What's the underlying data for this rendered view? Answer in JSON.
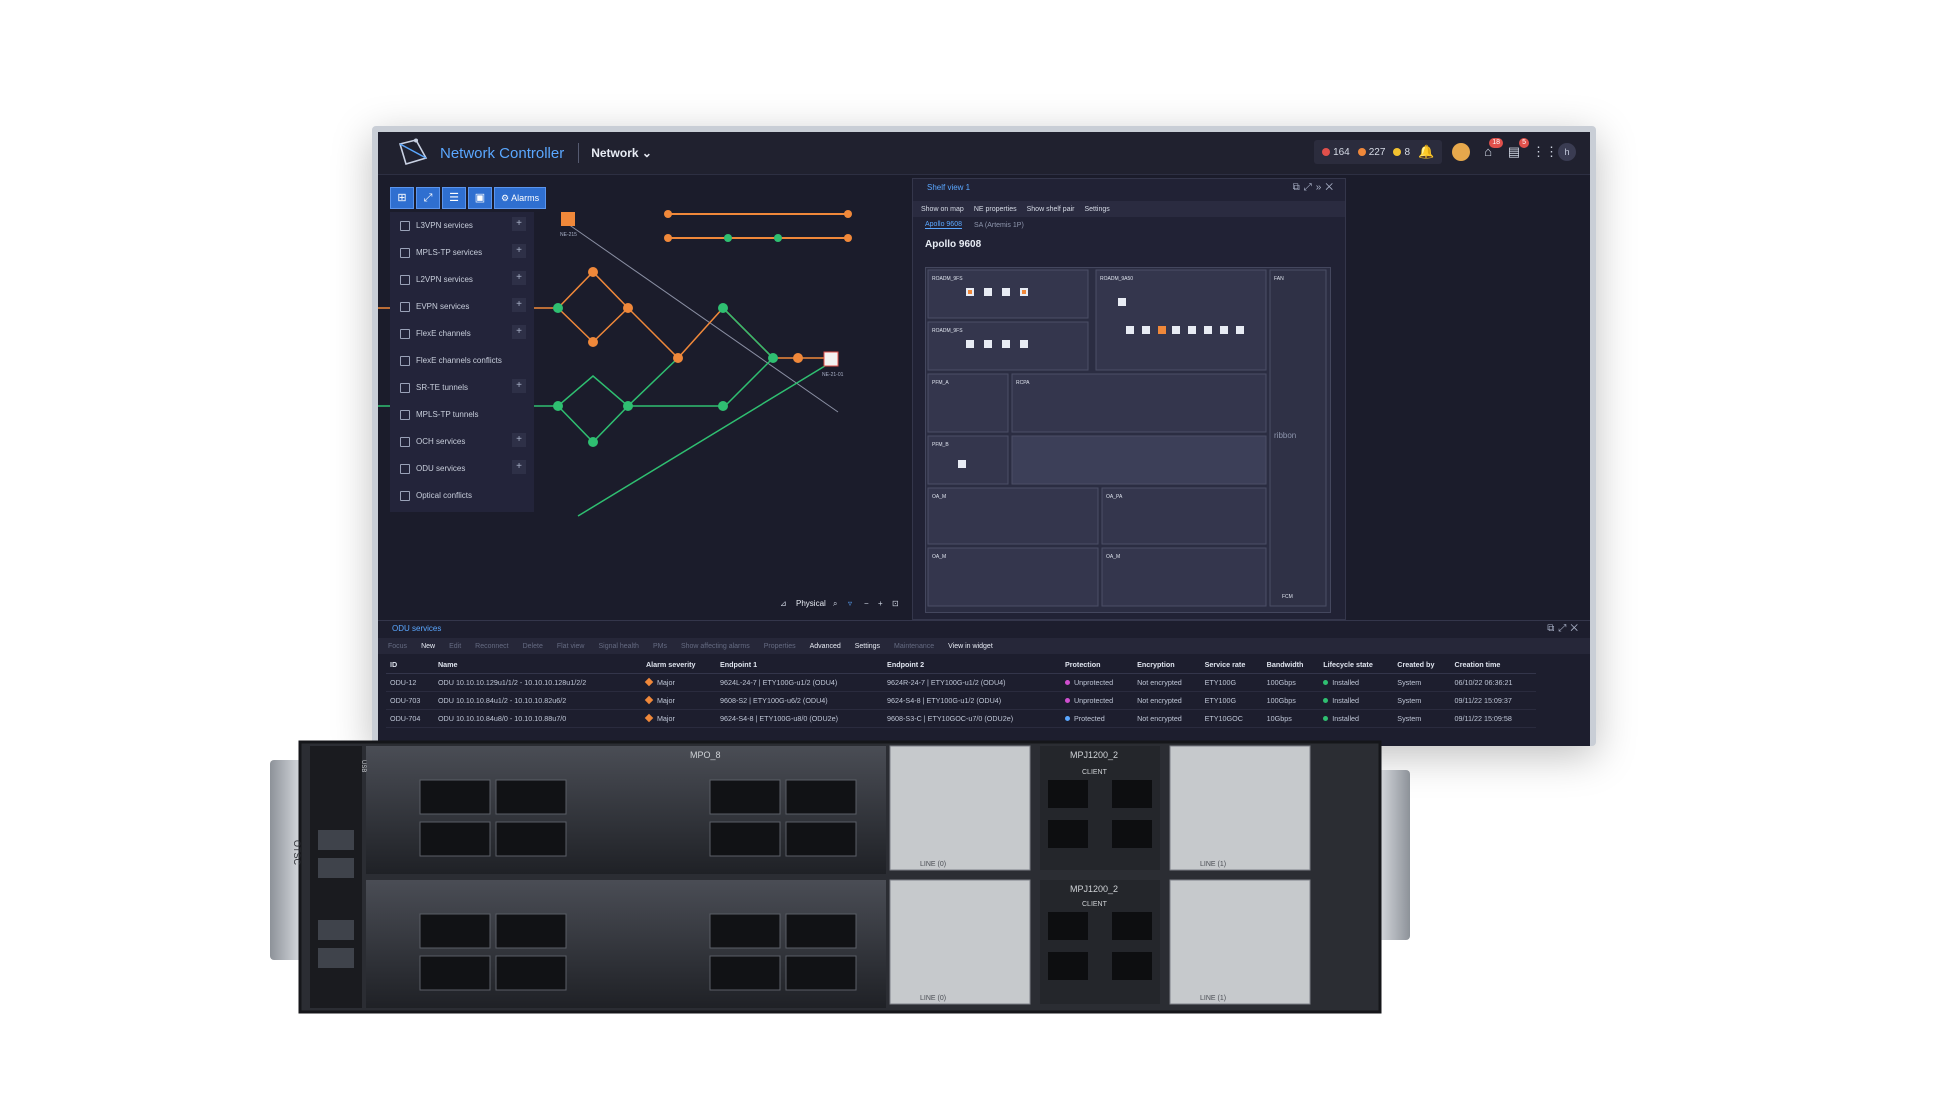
{
  "app": {
    "title": "Network Controller",
    "menu": "Network",
    "alarm_counts": {
      "critical": "164",
      "major": "227",
      "minor": "8"
    },
    "notif_badges": [
      "18",
      "5"
    ],
    "user_initial": "h"
  },
  "toolbar": {
    "alarms_label": "Alarms"
  },
  "services": [
    {
      "label": "L3VPN services",
      "plus": true
    },
    {
      "label": "MPLS-TP services",
      "plus": true
    },
    {
      "label": "L2VPN services",
      "plus": true
    },
    {
      "label": "EVPN services",
      "plus": true
    },
    {
      "label": "FlexE channels",
      "plus": true
    },
    {
      "label": "FlexE channels conflicts",
      "plus": false
    },
    {
      "label": "SR-TE tunnels",
      "plus": true
    },
    {
      "label": "MPLS-TP tunnels",
      "plus": false
    },
    {
      "label": "OCH services",
      "plus": true
    },
    {
      "label": "ODU services",
      "plus": true
    },
    {
      "label": "Optical conflicts",
      "plus": false
    }
  ],
  "topology": {
    "view_label": "Physical",
    "node_labels": {
      "ne1": "NE-215",
      "ne2": "NE-21-01"
    }
  },
  "shelf": {
    "panel_title": "Shelf view 1",
    "tools": [
      "Show on map",
      "NE properties",
      "Show shelf pair",
      "Settings"
    ],
    "tabs": [
      "Apollo 9608",
      "SA (Artemis 1P)"
    ],
    "title": "Apollo 9608",
    "slots": [
      "ROADM_9FS",
      "ROADM_9FS",
      "PFM_A",
      "PFM_B",
      "OA_M",
      "OA_M",
      "ROADM_9A50",
      "RCPA",
      "OA_PA",
      "OA_M",
      "FAN",
      "FCM"
    ],
    "brand": "ribbon"
  },
  "odu": {
    "panel_title": "ODU services",
    "tools": [
      "Focus",
      "New",
      "Edit",
      "Reconnect",
      "Delete",
      "Flat view",
      "Signal health",
      "PMs",
      "Show affecting alarms",
      "Properties",
      "Advanced",
      "Settings",
      "Maintenance",
      "View in widget"
    ],
    "columns": [
      "ID",
      "Name",
      "Alarm severity",
      "Endpoint 1",
      "Endpoint 2",
      "Protection",
      "Encryption",
      "Service rate",
      "Bandwidth",
      "Lifecycle state",
      "Created by",
      "Creation time"
    ],
    "rows": [
      {
        "id": "ODU-12",
        "name": "ODU 10.10.10.129u1/1/2 - 10.10.10.128u1/2/2",
        "severity": "Major",
        "ep1": "9624L-24-7 | ETY100G-u1/2 (ODU4)",
        "ep2": "9624R-24-7 | ETY100G-u1/2 (ODU4)",
        "protection": "Unprotected",
        "encryption": "Not encrypted",
        "rate": "ETY100G",
        "bandwidth": "100Gbps",
        "state": "Installed",
        "created_by": "System",
        "time": "06/10/22 06:36:21"
      },
      {
        "id": "ODU-703",
        "name": "ODU 10.10.10.84u1/2 - 10.10.10.82u6/2",
        "severity": "Major",
        "ep1": "9608-S2 | ETY100G-u6/2 (ODU4)",
        "ep2": "9624-S4-8 | ETY100G-u1/2 (ODU4)",
        "protection": "Unprotected",
        "encryption": "Not encrypted",
        "rate": "ETY100G",
        "bandwidth": "100Gbps",
        "state": "Installed",
        "created_by": "System",
        "time": "09/11/22 15:09:37"
      },
      {
        "id": "ODU-704",
        "name": "ODU 10.10.10.84u8/0 - 10.10.10.88u7/0",
        "severity": "Major",
        "ep1": "9624-S4-8 | ETY100G-u8/0 (ODU2e)",
        "ep2": "9608-S3-C | ETY10GOC-u7/0 (ODU2e)",
        "protection": "Protected",
        "encryption": "Not encrypted",
        "rate": "ETY10GOC",
        "bandwidth": "10Gbps",
        "state": "Installed",
        "created_by": "System",
        "time": "09/11/22 15:09:58"
      }
    ]
  },
  "hardware": {
    "module_labels": [
      "MPO_8",
      "MPJ1200_2",
      "MPJ1200_2",
      "CLIENT",
      "CLIENT",
      "LINE (0)",
      "LINE (1)",
      "LINE (0)",
      "LINE (1)",
      "OTSC",
      "USB"
    ]
  },
  "colors": {
    "accent": "#5aa7ff",
    "orange": "#f0883a",
    "green": "#2fbf71",
    "bg": "#1b1c2b"
  }
}
